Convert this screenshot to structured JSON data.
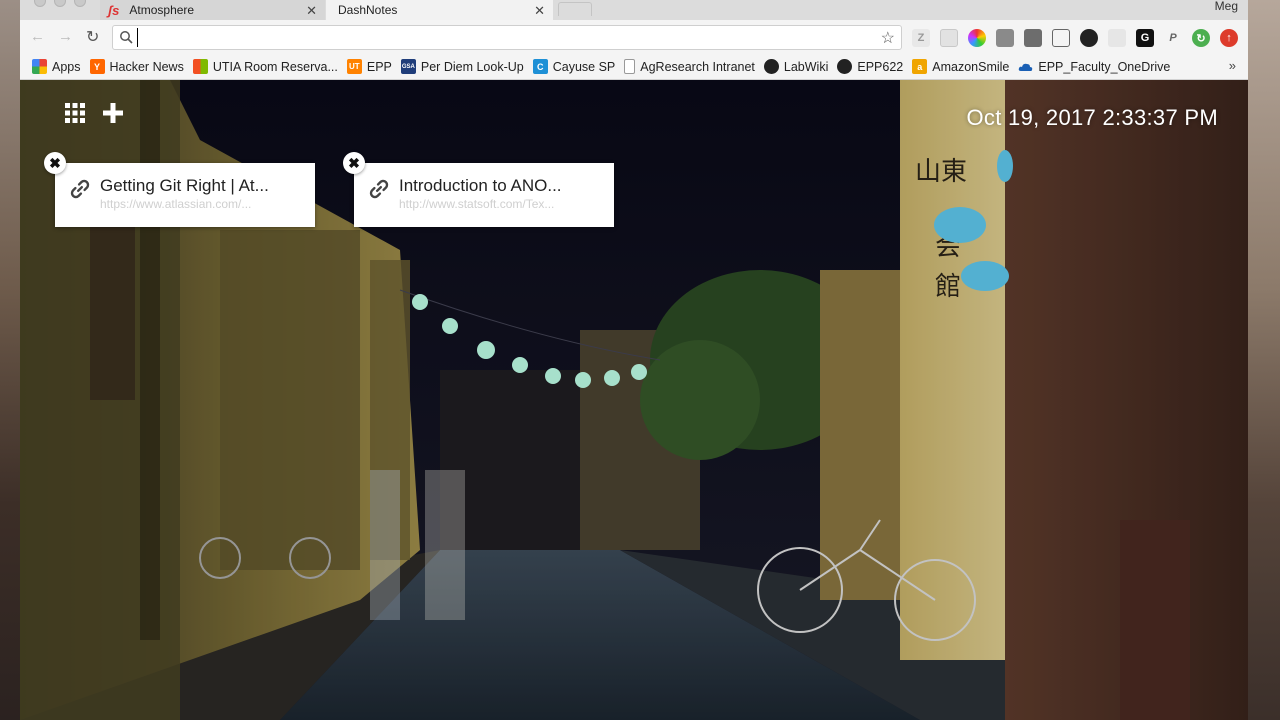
{
  "browser": {
    "tabs": [
      {
        "label": "Atmosphere",
        "favicon": "js-icon"
      },
      {
        "label": "DashNotes",
        "favicon": ""
      }
    ],
    "profile": "Meg",
    "omnibox": {
      "value": "",
      "placeholder": ""
    }
  },
  "bookmarks": [
    {
      "label": "Apps",
      "icon": "apps-grid-icon",
      "color": "#4285f4"
    },
    {
      "label": "Hacker News",
      "icon": "hacker-news-icon",
      "color": "#ff6600",
      "glyph": "Y"
    },
    {
      "label": "UTIA Room Reserva...",
      "icon": "windows-icon",
      "color": "#00a4ef"
    },
    {
      "label": "EPP",
      "icon": "ut-icon",
      "color": "#ff8200",
      "glyph": "UT"
    },
    {
      "label": "Per Diem Look-Up",
      "icon": "gsa-icon",
      "color": "#1f3d7a",
      "glyph": "GSA"
    },
    {
      "label": "Cayuse SP",
      "icon": "cayuse-icon",
      "color": "#1e90d6",
      "glyph": "C"
    },
    {
      "label": "AgResearch Intranet",
      "icon": "page-icon",
      "color": "#ffffff"
    },
    {
      "label": "LabWiki",
      "icon": "github-icon",
      "color": "#222222"
    },
    {
      "label": "EPP622",
      "icon": "github-icon",
      "color": "#222222"
    },
    {
      "label": "AmazonSmile",
      "icon": "amazon-icon",
      "color": "#f0a500",
      "glyph": "a"
    },
    {
      "label": "EPP_Faculty_OneDrive",
      "icon": "onedrive-icon",
      "color": "#1a5fb4"
    }
  ],
  "dashboard": {
    "clock": "Oct 19, 2017 2:33:37 PM",
    "cards": [
      {
        "title": "Getting Git Right | At...",
        "url": "https://www.atlassian.com/..."
      },
      {
        "title": "Introduction to ANO...",
        "url": "http://www.statsoft.com/Tex..."
      }
    ]
  }
}
